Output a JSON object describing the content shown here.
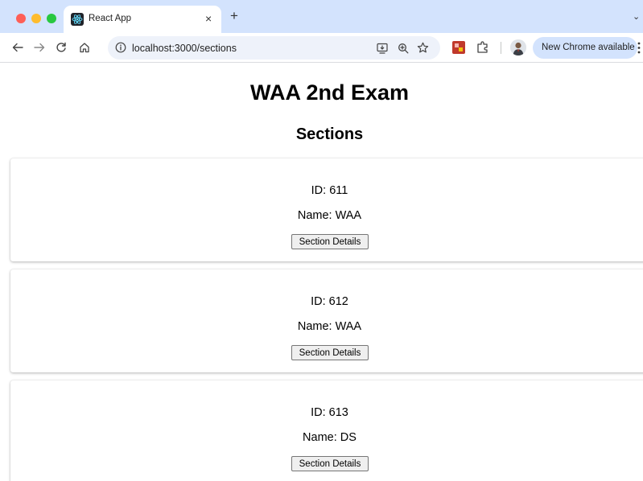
{
  "browser": {
    "tab": {
      "title": "React App",
      "close_glyph": "×",
      "favicon": "react-icon"
    },
    "new_tab_glyph": "+",
    "tab_overflow_glyph": "⌄",
    "nav": {
      "back_glyph": "←",
      "forward_glyph": "→",
      "reload_glyph": "C"
    },
    "address": {
      "url": "localhost:3000/sections"
    },
    "update_button": {
      "label": "New Chrome available"
    }
  },
  "page": {
    "title": "WAA 2nd Exam",
    "subtitle": "Sections",
    "sections": [
      {
        "id_text": "ID: 611",
        "name_text": "Name: WAA",
        "button_label": "Section Details"
      },
      {
        "id_text": "ID: 612",
        "name_text": "Name: WAA",
        "button_label": "Section Details"
      },
      {
        "id_text": "ID: 613",
        "name_text": "Name: DS",
        "button_label": "Section Details"
      }
    ]
  },
  "colors": {
    "tabstrip_bg": "#d3e3fd",
    "omnibox_bg": "#eef2fa",
    "traffic_red": "#fe5f57",
    "traffic_yellow": "#febc2e",
    "traffic_green": "#28c840"
  }
}
